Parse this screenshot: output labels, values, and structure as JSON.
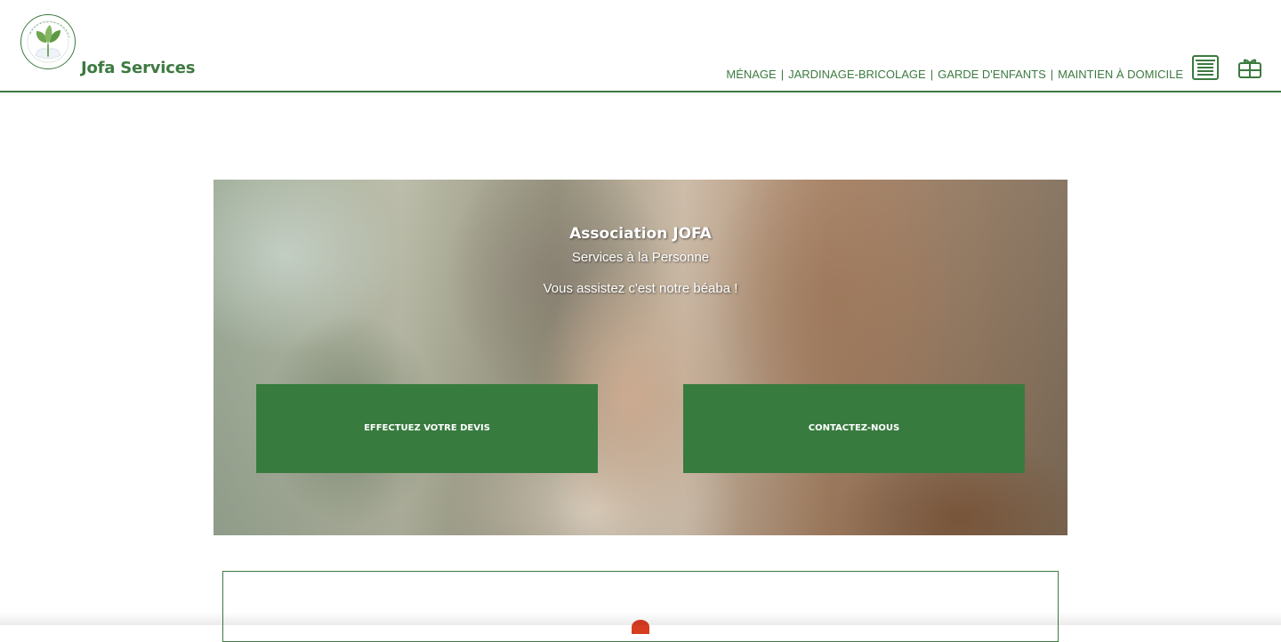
{
  "site": {
    "title": "Jofa Services",
    "logo_icon": "leaf-logo-icon",
    "brand_color": "#3d7a40"
  },
  "nav": {
    "items": [
      "MÉNAGE",
      "JARDINAGE-BRICOLAGE",
      "GARDE D'ENFANTS",
      "MAINTIEN À DOMICILE"
    ],
    "separator": "|",
    "icons": [
      "spreadsheet-icon",
      "gift-card-icon"
    ]
  },
  "hero": {
    "title": "Association JOFA",
    "subtitle": "Services à la Personne",
    "tagline": "Vous assistez c'est notre béaba !",
    "buttons": [
      "EFFECTUEZ VOTRE DEVIS",
      "CONTACTEZ-NOUS"
    ],
    "button_color": "#387b3f"
  },
  "section": {
    "border_color": "#3d7a40",
    "accent_icon": "red-badge-icon",
    "accent_color": "#d73c21"
  }
}
